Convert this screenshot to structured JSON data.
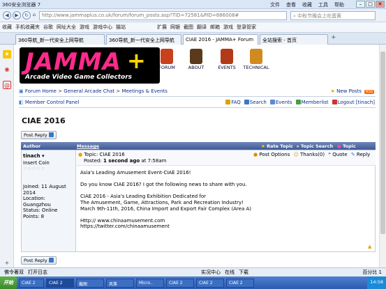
{
  "browser": {
    "title": "360安全浏览器 7",
    "menus": [
      "文件",
      "查看",
      "收藏",
      "工具",
      "帮助"
    ],
    "url": "http://www.jammaplus.co.uk/forum/forum_posts.asp?TID=72581&PID=686008#",
    "search_placeholder": "中秋节晚会上吃蛋黄",
    "favorites": [
      "收藏",
      "手机收藏夹",
      "谷歌",
      "网址大全",
      "游戏",
      "游戏中心",
      "猫站",
      "扩展",
      "网银",
      "截图",
      "翻译",
      "邮箱",
      "游戏",
      "登录管家"
    ],
    "tabs": [
      {
        "label": "360导航_新一代安全上网导航",
        "active": false
      },
      {
        "label": "360导航_新一代安全上网导航",
        "active": false
      },
      {
        "label": "CIAE 2016 - JAMMA+ Forum",
        "active": true
      },
      {
        "label": "全站搜索 - 首页",
        "active": false
      }
    ]
  },
  "site": {
    "logo_text": "JAMMA",
    "logo_plus": "+",
    "logo_subtitle": "Arcade Video Game Collectors",
    "nav": [
      {
        "label": "FORUM",
        "icon": "forum-icon",
        "color": "#c8411c"
      },
      {
        "label": "ABOUT",
        "icon": "about-icon",
        "color": "#5a3a1a"
      },
      {
        "label": "EVENTS",
        "icon": "events-icon",
        "color": "#b33a18"
      },
      {
        "label": "TECHNICAL",
        "icon": "technical-icon",
        "color": "#d08a20"
      }
    ]
  },
  "breadcrumb": {
    "home": "Forum Home",
    "sep": ">",
    "chat": "General Arcade Chat",
    "section": "Meetings & Events"
  },
  "new_posts": "New Posts",
  "rss": "RSS",
  "member_cp": "Member Control Panel",
  "toolbar": [
    "FAQ",
    "Search",
    "Events",
    "Memberlist",
    "Logout [tinach]"
  ],
  "page_title": "CIAE 2016",
  "post_reply": "Post Reply",
  "table": {
    "author_header": "Author",
    "message_header": "Message",
    "rate": "Rate Topic",
    "topic_search": "Topic Search",
    "topic_options": "Topic Options"
  },
  "post": {
    "author": "tinach",
    "rank": "Insert Coin",
    "joined": "Joined: 11 August 2014",
    "location": "Location: Guangzhou",
    "status": "Status: Online",
    "points": "Points: 8",
    "topic": "Topic: CIAE 2016",
    "posted_prefix": "Posted: ",
    "posted_bold": "1 second ago",
    "posted_suffix": " at 7:58am",
    "post_options": "Post Options",
    "thanks": "Thanks(0)",
    "quote": "Quote",
    "reply": "Reply",
    "lines": [
      "Asia's Leading Amusement Event-CIAE 2016!",
      "",
      "Do you know CIAE 2016? I got the following news to share with you.",
      "",
      "CIAE 2016 - Asia's Leading Exhibition Dedicated for",
      "The Amusement, Game, Attractions, Park and Recreation Industry!",
      "March 9th-11th, 2016, China Import and Export Fair Complex (Area A)",
      "",
      "Http:// www.chinaamusement.com",
      "https://twitter.com/chinaamusement"
    ]
  },
  "status": [
    "佛令著双",
    "打开日志",
    "实况中心",
    "在线",
    "下载",
    "百分比 1"
  ],
  "taskbar": {
    "start": "开始",
    "items": [
      "CIAE 2",
      "CIAE 2",
      "截图",
      "风筝",
      "Micro..",
      "CIAE 2",
      "CIAE 2",
      "CIAE 2"
    ],
    "clock": "14:58"
  }
}
